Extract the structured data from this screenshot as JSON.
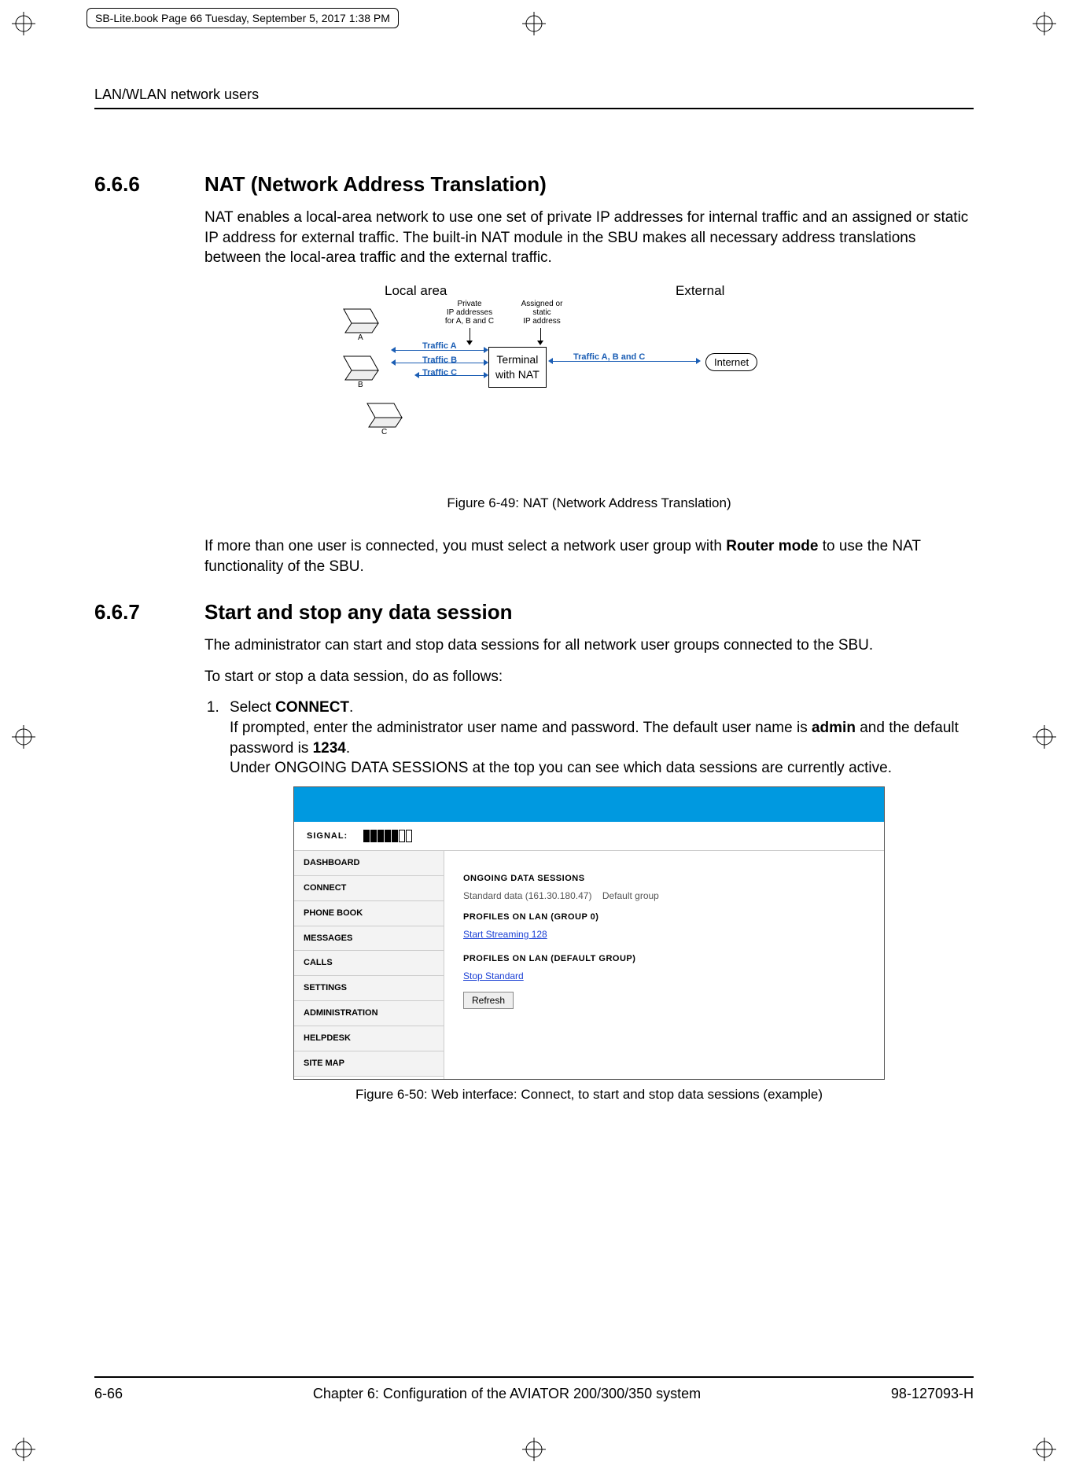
{
  "book_tab": "SB-Lite.book  Page 66  Tuesday, September 5, 2017  1:38 PM",
  "running_head": "LAN/WLAN network users",
  "s666": {
    "num": "6.6.6",
    "title": "NAT (Network Address Translation)",
    "para": "NAT enables a local-area network to use one set of private IP addresses for internal traffic and an assigned or static IP address for external traffic. The built-in NAT module in the SBU makes all necessary address translations between the local-area traffic and the external traffic.",
    "fig": {
      "local_label": "Local area",
      "external_label": "External",
      "priv_label": "Private\nIP addresses\nfor A, B and C",
      "static_label": "Assigned or\nstatic\nIP address",
      "terminal": "Terminal\nwith NAT",
      "traffic_a": "Traffic A",
      "traffic_b": "Traffic B",
      "traffic_c": "Traffic C",
      "traffic_abc": "Traffic A, B and C",
      "internet": "Internet",
      "letters": {
        "a": "A",
        "b": "B",
        "c": "C"
      },
      "caption": "Figure 6-49: NAT (Network Address Translation)"
    },
    "after": {
      "pre": "If more than one user is connected, you must select a network user group with ",
      "bold": "Router mode",
      "post": " to use the NAT functionality of the SBU."
    }
  },
  "s667": {
    "num": "6.6.7",
    "title": "Start and stop any data session",
    "p1": "The administrator can start and stop data sessions for all network user groups connected to the SBU.",
    "p2": "To start or stop a data session, do as follows:",
    "step1": {
      "lead": "Select ",
      "bold": "CONNECT",
      "dot": ".",
      "l2a": "If prompted, enter the administrator user name and password. The default user name is ",
      "l2b": "admin",
      "l2c": " and the default password is ",
      "l2d": "1234",
      "l2e": ".",
      "l3": "Under ONGOING DATA SESSIONS at the top you can see which data sessions are currently active."
    },
    "webshot": {
      "signal_label": "SIGNAL:",
      "nav": [
        "DASHBOARD",
        "CONNECT",
        "PHONE BOOK",
        "MESSAGES",
        "CALLS",
        "SETTINGS",
        "ADMINISTRATION",
        "HELPDESK",
        "SITE MAP"
      ],
      "h1": "ONGOING DATA SESSIONS",
      "row1a": "Standard data (161.30.180.47)",
      "row1b": "Default group",
      "h2": "PROFILES ON LAN (GROUP 0)",
      "link1": "Start Streaming 128",
      "h3": "PROFILES ON LAN (DEFAULT GROUP)",
      "link2": "Stop Standard",
      "btn": "Refresh"
    },
    "figcap": "Figure 6-50: Web interface: Connect, to start and stop data sessions (example)"
  },
  "footer": {
    "left": "6-66",
    "center": "Chapter 6:  Configuration of the AVIATOR 200/300/350 system",
    "right": "98-127093-H"
  }
}
